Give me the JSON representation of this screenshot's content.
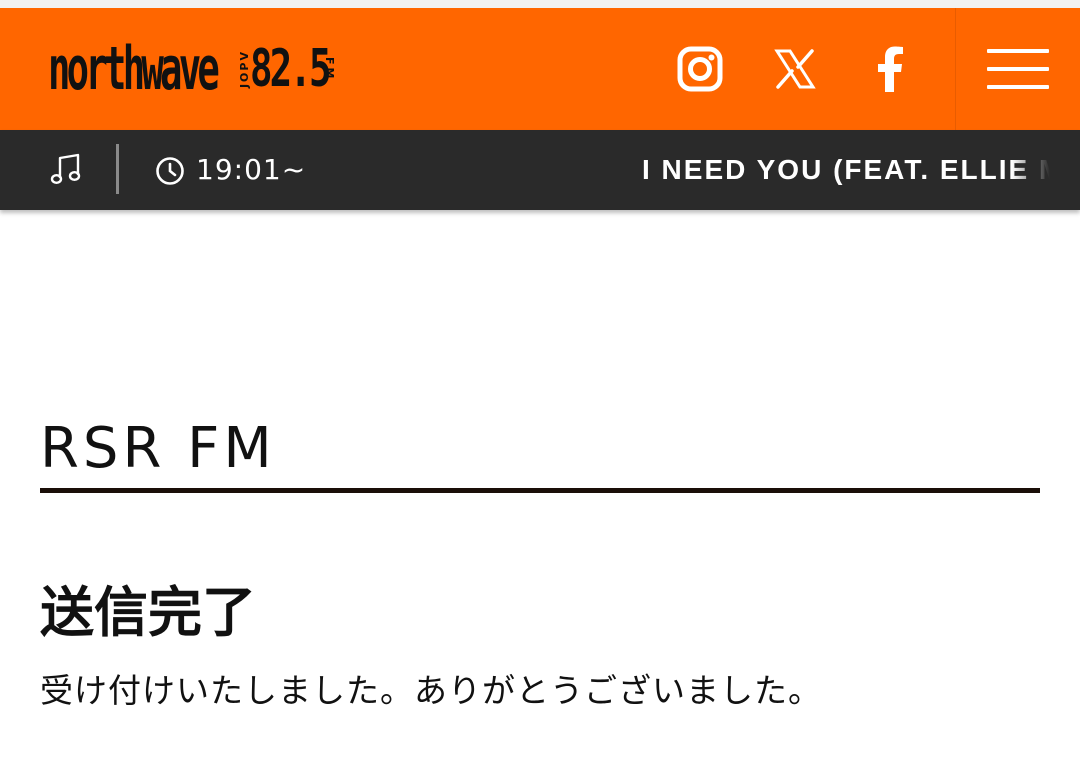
{
  "header": {
    "logo": {
      "wordmark": "northwave",
      "side_text": "JOPV",
      "frequency": "82.5",
      "band": "FM"
    },
    "social": [
      {
        "name": "instagram",
        "icon": "instagram-icon"
      },
      {
        "name": "x",
        "icon": "x-logo-icon"
      },
      {
        "name": "facebook",
        "icon": "facebook-icon"
      }
    ],
    "menu_icon": "hamburger-menu-icon",
    "colors": {
      "brand": "#ff6600",
      "nowbar": "#2a2a2a"
    }
  },
  "now_playing": {
    "note_icon": "music-note-icon",
    "clock_icon": "clock-icon",
    "time": "19:01~",
    "title": "I NEED YOU (FEAT. ELLIE M"
  },
  "main": {
    "page_title": "RSR FM",
    "complete_title": "送信完了",
    "complete_message": "受け付けいたしました。ありがとうございました。"
  }
}
